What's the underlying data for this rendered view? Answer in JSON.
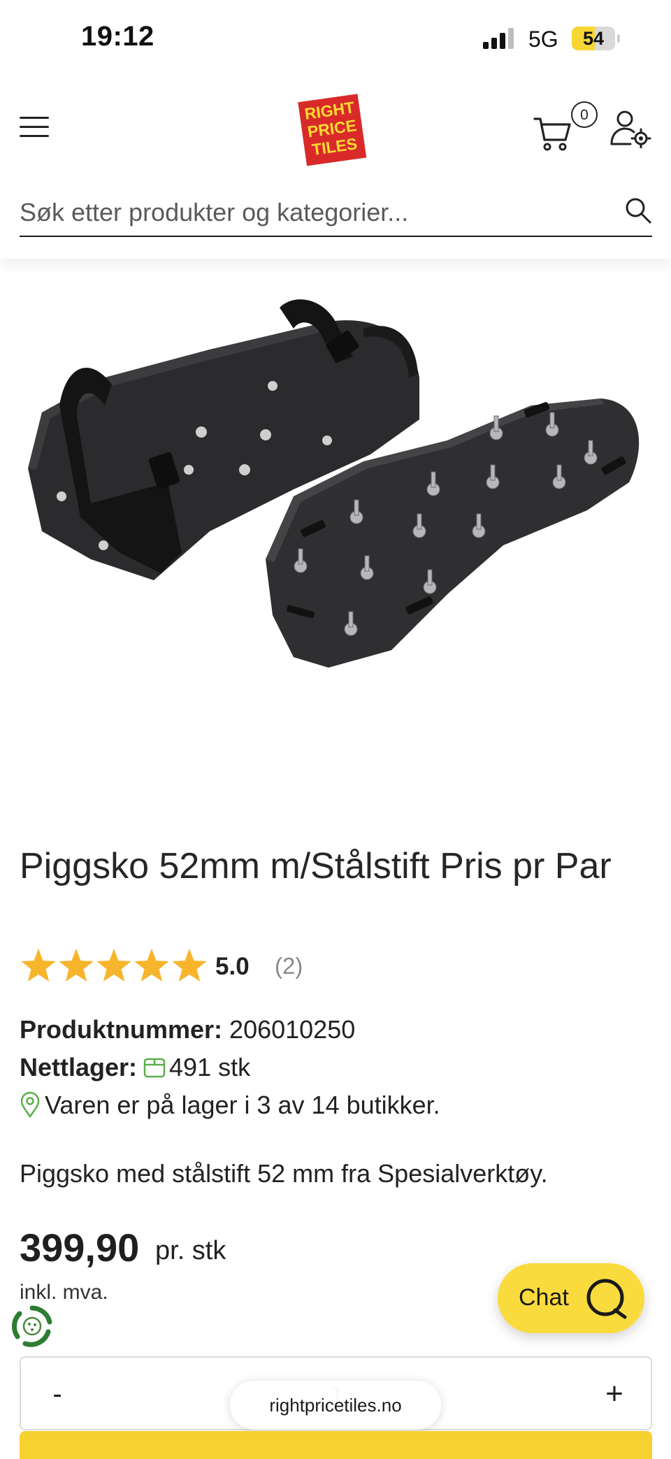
{
  "status_bar": {
    "time": "19:12",
    "network": "5G",
    "battery": "54",
    "battery_level": 0.54
  },
  "header": {
    "logo_lines": [
      "RIGHT",
      "PRICE",
      "TILES"
    ],
    "cart_count": "0",
    "search_placeholder": "Søk etter produkter og kategorier..."
  },
  "product": {
    "title": "Piggsko 52mm m/Stålstift Pris pr Par",
    "rating": {
      "stars": 5,
      "value": "5.0",
      "count": "(2)"
    },
    "product_number_label": "Produktnummer:",
    "product_number": "206010250",
    "stock_label": "Nettlager:",
    "stock_value": "491 stk",
    "store_availability": "Varen er på lager i 3 av 14 butikker.",
    "description": "Piggsko med stålstift 52 mm fra Spesialverktøy.",
    "price": "399,90",
    "price_unit": "pr. stk",
    "vat_note": "inkl. mva."
  },
  "chat": {
    "label": "Chat"
  },
  "quantity": {
    "minus": "-",
    "plus": "+",
    "value": "1"
  },
  "browser": {
    "url": "rightpricetiles.no"
  },
  "colors": {
    "accent_yellow": "#f9db3d",
    "logo_red": "#d92a2a",
    "star": "#f7b52c",
    "green_icon": "#5ab04a"
  }
}
